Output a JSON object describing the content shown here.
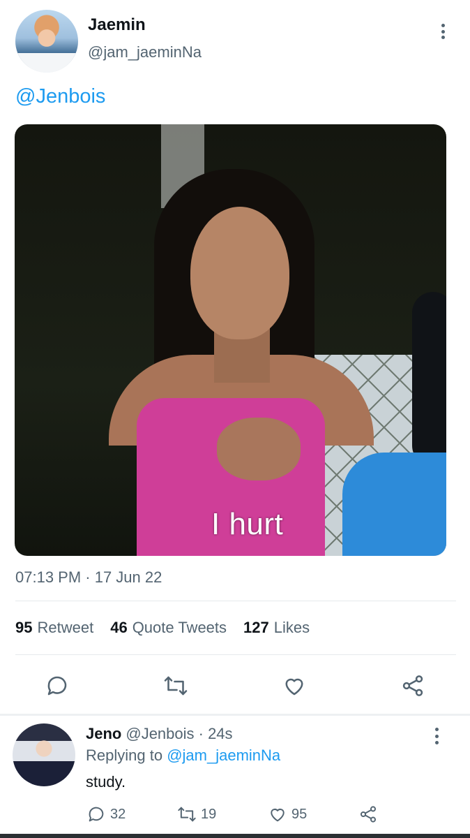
{
  "tweet": {
    "display_name": "Jaemin",
    "handle": "@jam_jaeminNa",
    "text": "@Jenbois",
    "image_caption": "I hurt",
    "timestamp": "07:13 PM · 17 Jun 22",
    "stats": [
      {
        "count": "95",
        "label": "Retweet"
      },
      {
        "count": "46",
        "label": "Quote Tweets"
      },
      {
        "count": "127",
        "label": "Likes"
      }
    ],
    "actions": [
      "reply-icon",
      "retweet-icon",
      "like-icon",
      "share-icon"
    ]
  },
  "reply": {
    "display_name": "Jeno",
    "handle_time": "@Jenbois · 24s",
    "replying_prefix": "Replying to",
    "replying_handle": "@jam_jaeminNa",
    "text": "study.",
    "reply_count": "32",
    "retweet_count": "19",
    "like_count": "95"
  },
  "colors": {
    "accent": "#1d9bf0",
    "secondary_text": "#536471",
    "primary_text": "#0f1419"
  }
}
